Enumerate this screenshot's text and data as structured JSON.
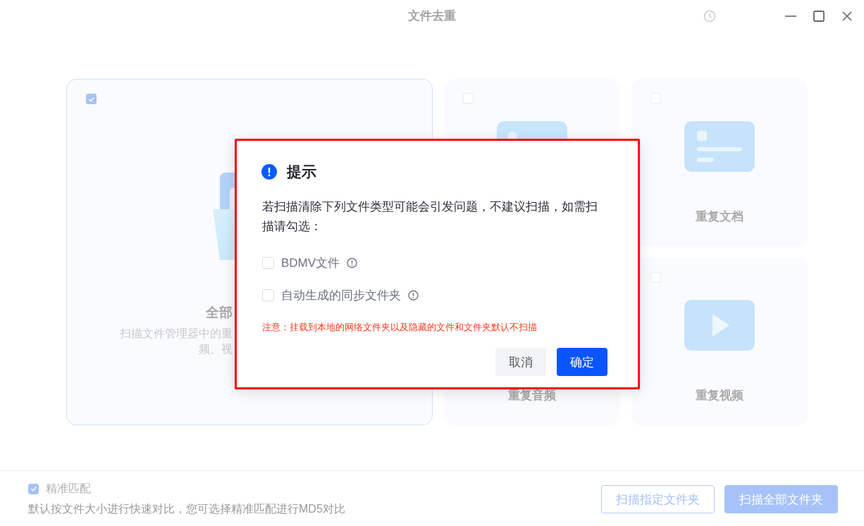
{
  "window": {
    "title": "文件去重"
  },
  "cards": [
    {
      "kind": "all",
      "checked": true,
      "title": "全部",
      "description_lines": [
        "扫描文件管理器中的重",
        "频、视"
      ]
    },
    {
      "kind": "image",
      "checked": false
    },
    {
      "kind": "document",
      "checked": false,
      "title": "重复文档"
    },
    {
      "kind": "audio",
      "title": "重复音频"
    },
    {
      "kind": "video",
      "checked": false,
      "title": "重复视频"
    }
  ],
  "footer": {
    "precise_match": {
      "label": "精准匹配",
      "checked": true
    },
    "hint": "默认按文件大小进行快速对比，您可选择精准匹配进行MD5对比",
    "buttons": [
      {
        "label": "扫描指定文件夹",
        "kind": "outline"
      },
      {
        "label": "扫描全部文件夹",
        "kind": "primary"
      }
    ]
  },
  "dialog": {
    "title": "提示",
    "highlighted": true,
    "message": "若扫描清除下列文件类型可能会引发问题，不建议扫描，如需扫描请勾选：",
    "options": [
      {
        "label": "BDMV文件",
        "checked": false
      },
      {
        "label": "自动生成的同步文件夹",
        "checked": false
      }
    ],
    "notice": "注意：挂载到本地的网络文件夹以及隐藏的文件和文件夹默认不扫描",
    "buttons": [
      {
        "label": "取消",
        "kind": "secondary"
      },
      {
        "label": "确定",
        "kind": "primary"
      }
    ]
  }
}
